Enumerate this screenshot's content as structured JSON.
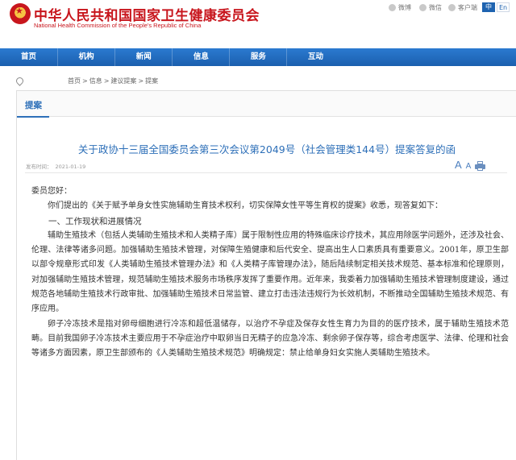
{
  "header": {
    "title": "中华人民共和国国家卫生健康委员会",
    "subtitle": "National Health Commission of the People's Republic of China",
    "social": [
      {
        "icon": "weibo-icon",
        "label": "微博"
      },
      {
        "icon": "wechat-icon",
        "label": "微信"
      },
      {
        "icon": "app-icon",
        "label": "客户端"
      }
    ],
    "lang_zh": "中",
    "lang_en": "En"
  },
  "nav": [
    "首页",
    "机构",
    "新闻",
    "信息",
    "服务",
    "互动"
  ],
  "breadcrumb": [
    "首页",
    "信息",
    "建议提案",
    "提案"
  ],
  "section": {
    "tab": "提案"
  },
  "article": {
    "title": "关于政协十三届全国委员会第三次会议第2049号（社会管理类144号）提案答复的函",
    "date_label": "发布时间：",
    "date": "2021-01-19",
    "font_large": "A",
    "font_small": "A",
    "greeting": "委员您好：",
    "paragraphs": [
      "你们提出的《关于赋予单身女性实施辅助生育技术权利，切实保障女性平等生育权的提案》收悉，现答复如下：",
      "辅助生殖技术（包括人类辅助生殖技术和人类精子库）属于限制性应用的特殊临床诊疗技术，其应用除医学问题外，还涉及社会、伦理、法律等诸多问题。加强辅助生殖技术管理，对保障生殖健康和后代安全、提高出生人口素质具有重要意义。2001年，原卫生部以部令规章形式印发《人类辅助生殖技术管理办法》和《人类精子库管理办法》，随后陆续制定相关技术规范、基本标准和伦理原则，对加强辅助生殖技术管理，规范辅助生殖技术服务市场秩序发挥了重要作用。近年来，我委着力加强辅助生殖技术管理制度建设，通过规范各地辅助生殖技术行政审批、加强辅助生殖技术日常监管、建立打击违法违规行为长效机制，不断推动全国辅助生殖技术规范、有序应用。",
      "卵子冷冻技术是指对卵母细胞进行冷冻和超低温储存，以治疗不孕症及保存女性生育力为目的的医疗技术，属于辅助生殖技术范畴。目前我国卵子冷冻技术主要应用于不孕症治疗中取卵当日无精子的应急冷冻、剩余卵子保存等，综合考虑医学、法律、伦理和社会等诸多方面因素，原卫生部颁布的《人类辅助生殖技术规范》明确规定：禁止给单身妇女实施人类辅助生殖技术。"
    ],
    "heading1": "一、工作现状和进展情况"
  }
}
